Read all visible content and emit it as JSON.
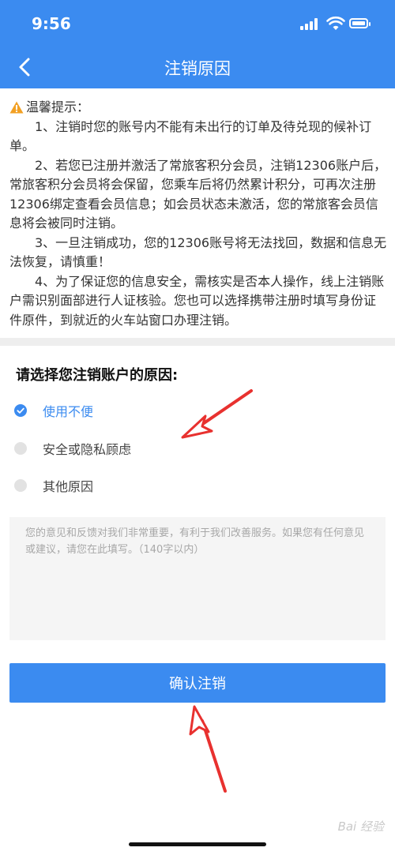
{
  "status_bar": {
    "time": "9:56"
  },
  "nav": {
    "title": "注销原因"
  },
  "notice": {
    "title": "温馨提示：",
    "paragraphs": [
      "1、注销时您的账号内不能有未出行的订单及待兑现的候补订单。",
      "2、若您已注册并激活了常旅客积分会员，注销12306账户后，常旅客积分会员将会保留，您乘车后将仍然累计积分，可再次注册12306绑定查看会员信息；如会员状态未激活，您的常旅客会员信息将会被同时注销。",
      "3、一旦注销成功，您的12306账号将无法找回，数据和信息无法恢复，请慎重！",
      "4、为了保证您的信息安全，需核实是否本人操作，线上注销账户需识别面部进行人证核验。您也可以选择携带注册时填写身份证件原件，到就近的火车站窗口办理注销。"
    ]
  },
  "reason": {
    "heading": "请选择您注销账户的原因:",
    "options": [
      {
        "label": "使用不便",
        "selected": true
      },
      {
        "label": "安全或隐私顾虑",
        "selected": false
      },
      {
        "label": "其他原因",
        "selected": false
      }
    ]
  },
  "feedback": {
    "placeholder": "您的意见和反馈对我们非常重要，有利于我们改善服务。如果您有任何意见或建议，请您在此填写。（140字以内）"
  },
  "confirm_button": {
    "label": "确认注销"
  },
  "watermark": {
    "text": "Bai 经验"
  },
  "colors": {
    "primary": "#3b8bf0",
    "annotation_arrow": "#e8312f"
  },
  "icons": {
    "back": "chevron-left-icon",
    "warning": "warning-icon"
  }
}
